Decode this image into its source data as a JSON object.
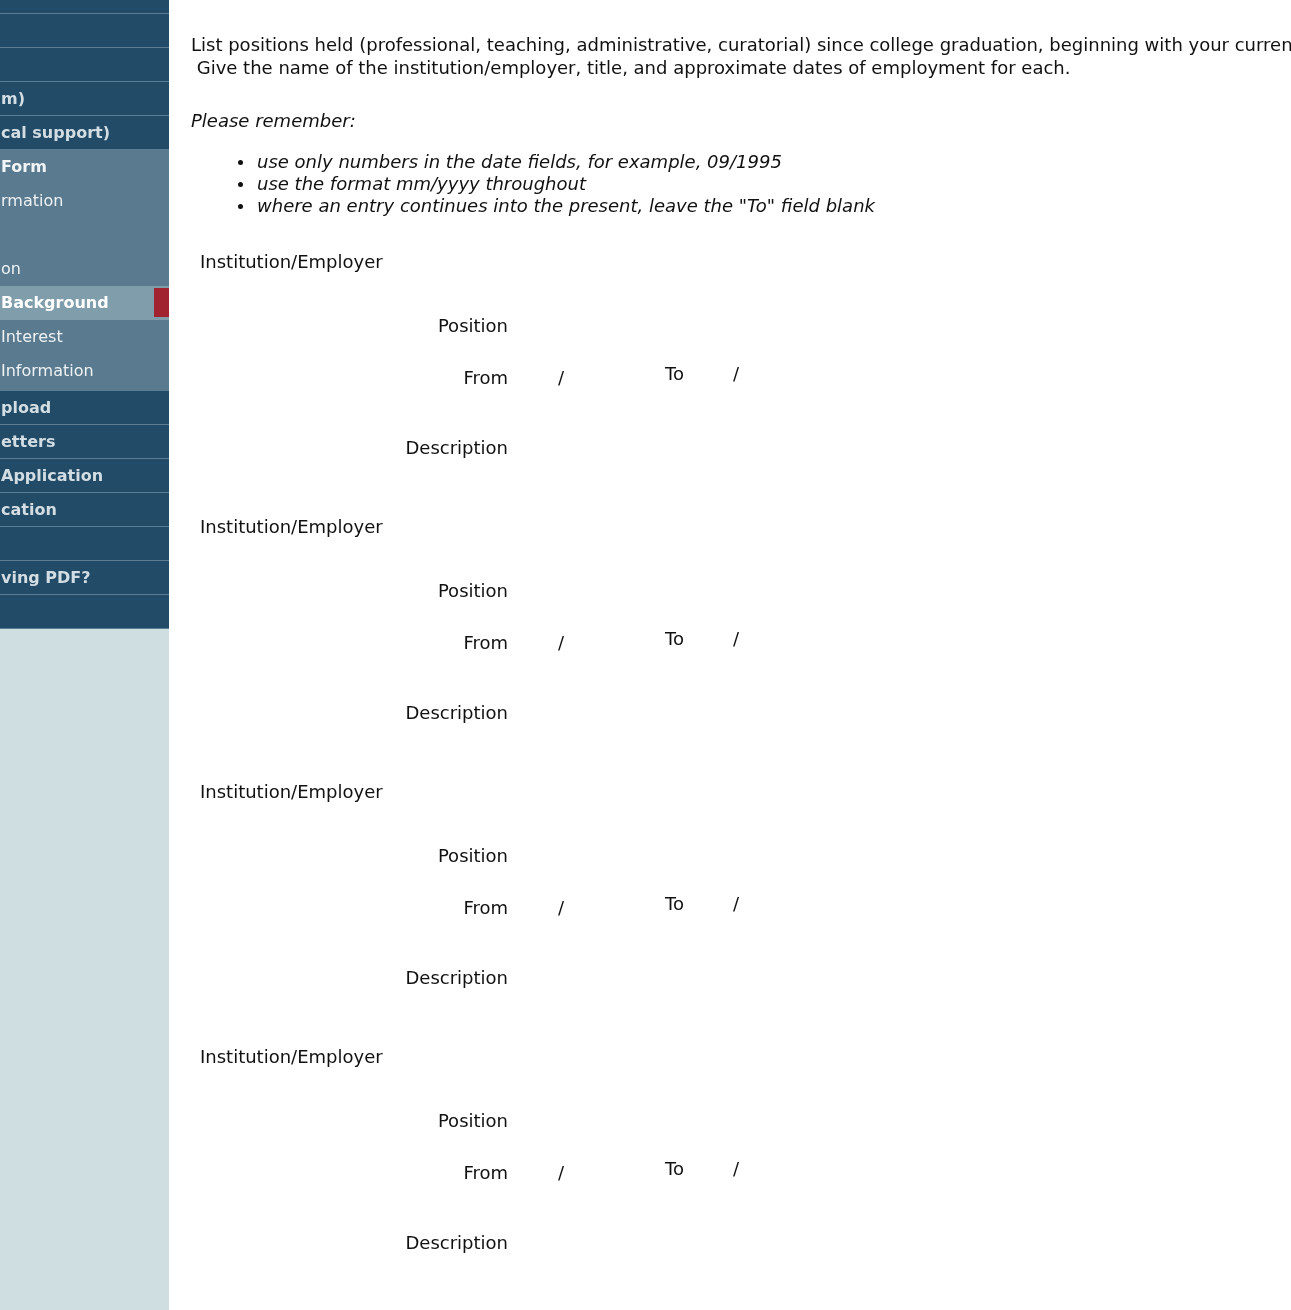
{
  "sidebar": {
    "items": [
      {
        "kind": "blank"
      },
      {
        "kind": "blank"
      },
      {
        "kind": "blank"
      },
      {
        "kind": "link",
        "label": "m)",
        "selected": false
      },
      {
        "kind": "link",
        "label": "cal support)",
        "selected": false
      },
      {
        "kind": "link",
        "label": "Form",
        "selected": false,
        "expanded": true,
        "children": [
          {
            "kind": "link",
            "label": "rmation",
            "selected": false
          },
          {
            "kind": "blank"
          },
          {
            "kind": "link",
            "label": "on",
            "selected": false
          },
          {
            "kind": "link",
            "label": "Background",
            "selected": true
          },
          {
            "kind": "link",
            "label": "Interest",
            "selected": false
          },
          {
            "kind": "link",
            "label": "Information",
            "selected": false
          }
        ]
      },
      {
        "kind": "link",
        "label": "pload",
        "selected": false
      },
      {
        "kind": "link",
        "label": "etters",
        "selected": false
      },
      {
        "kind": "link",
        "label": "Application",
        "selected": false
      },
      {
        "kind": "link",
        "label": "cation",
        "selected": false
      },
      {
        "kind": "blank"
      },
      {
        "kind": "link",
        "label": "ving PDF?",
        "selected": false
      },
      {
        "kind": "blank"
      }
    ]
  },
  "intro": [
    "List positions held (professional, teaching, administrative, curatorial) since college graduation, beginning with your curren",
    "Give the name of the institution/employer, title, and approximate dates of employment for each."
  ],
  "reminder": {
    "title": "Please remember:",
    "items": [
      "use only numbers in the date fields, for example, 09/1995",
      "use the format mm/yyyy throughout",
      "where an entry continues into the present, leave the \"To\" field blank"
    ]
  },
  "entries": [
    {
      "institution": "Institution/Employer",
      "position": "Position",
      "from": "From",
      "from_sep": "/",
      "to": "To",
      "to_sep": "/",
      "description": "Description"
    },
    {
      "institution": "Institution/Employer",
      "position": "Position",
      "from": "From",
      "from_sep": "/",
      "to": "To",
      "to_sep": "/",
      "description": "Description"
    },
    {
      "institution": "Institution/Employer",
      "position": "Position",
      "from": "From",
      "from_sep": "/",
      "to": "To",
      "to_sep": "/",
      "description": "Description"
    },
    {
      "institution": "Institution/Employer",
      "position": "Position",
      "from": "From",
      "from_sep": "/",
      "to": "To",
      "to_sep": "/",
      "description": "Description"
    }
  ]
}
